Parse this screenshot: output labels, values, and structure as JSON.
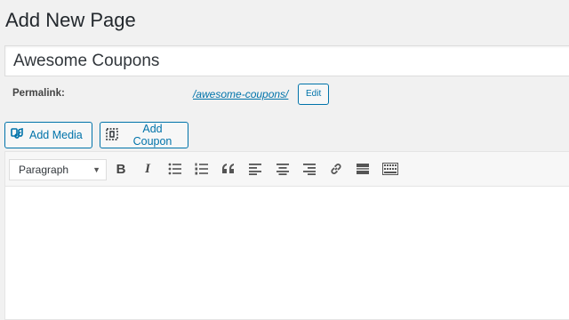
{
  "page": {
    "title": "Add New Page"
  },
  "post_title": {
    "value": "Awesome Coupons",
    "placeholder": ""
  },
  "permalink": {
    "label": "Permalink:",
    "slug": "/awesome-coupons/",
    "edit_label": "Edit"
  },
  "media_buttons": {
    "add_media": "Add Media",
    "add_coupon": "Add Coupon"
  },
  "toolbar": {
    "format_select": "Paragraph",
    "bold_label": "B",
    "italic_label": "I",
    "icons": [
      "bold-icon",
      "italic-icon",
      "bulleted-list-icon",
      "numbered-list-icon",
      "blockquote-icon",
      "align-left-icon",
      "align-center-icon",
      "align-right-icon",
      "link-icon",
      "read-more-icon",
      "toolbar-toggle-icon"
    ]
  },
  "colors": {
    "accent": "#0073aa",
    "background": "#f1f1f1",
    "text": "#23282d"
  }
}
